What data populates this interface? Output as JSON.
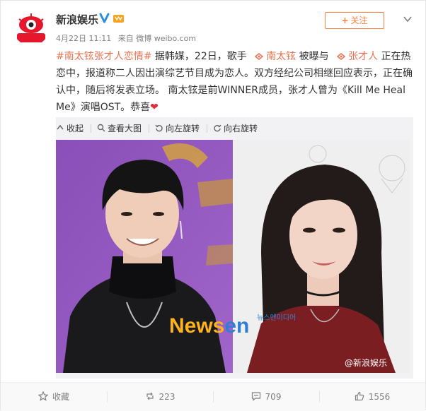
{
  "header": {
    "nickname": "新浪娱乐",
    "avatar_text": "新浪娱乐",
    "time": "4月22日 11:11",
    "source": "来自 微博 weibo.com",
    "follow_label": "关注"
  },
  "post": {
    "hashtag": "#南太铉张才人恋情#",
    "text1": " 据韩媒，22日，歌手 ",
    "mention1": "南太铉",
    "text2": " 被曝与 ",
    "mention2": "张才人",
    "text3": " 正在热恋中，报道称二人因出演综艺节目成为恋人。双方经纪公司相继回应表示，正在确认中，随后将发表立场。 南太铉是前WINNER成员，张才人曾为《Kill Me Heal Me》演唱OST。恭喜",
    "heart": "❤"
  },
  "media_tools": {
    "collapse": "收起",
    "view_large": "查看大图",
    "rotate_left": "向左旋转",
    "rotate_right": "向右旋转"
  },
  "watermark": {
    "newsen_a": "News",
    "newsen_b": "en",
    "korean": "뉴스엔미디어",
    "weibo": "@新浪娱乐"
  },
  "footer": {
    "favorite": "收藏",
    "repost": "223",
    "comment": "709",
    "like": "1556"
  },
  "colors": {
    "link": "#eb7350",
    "follow": "#ff8140",
    "heart": "#e0313b"
  }
}
